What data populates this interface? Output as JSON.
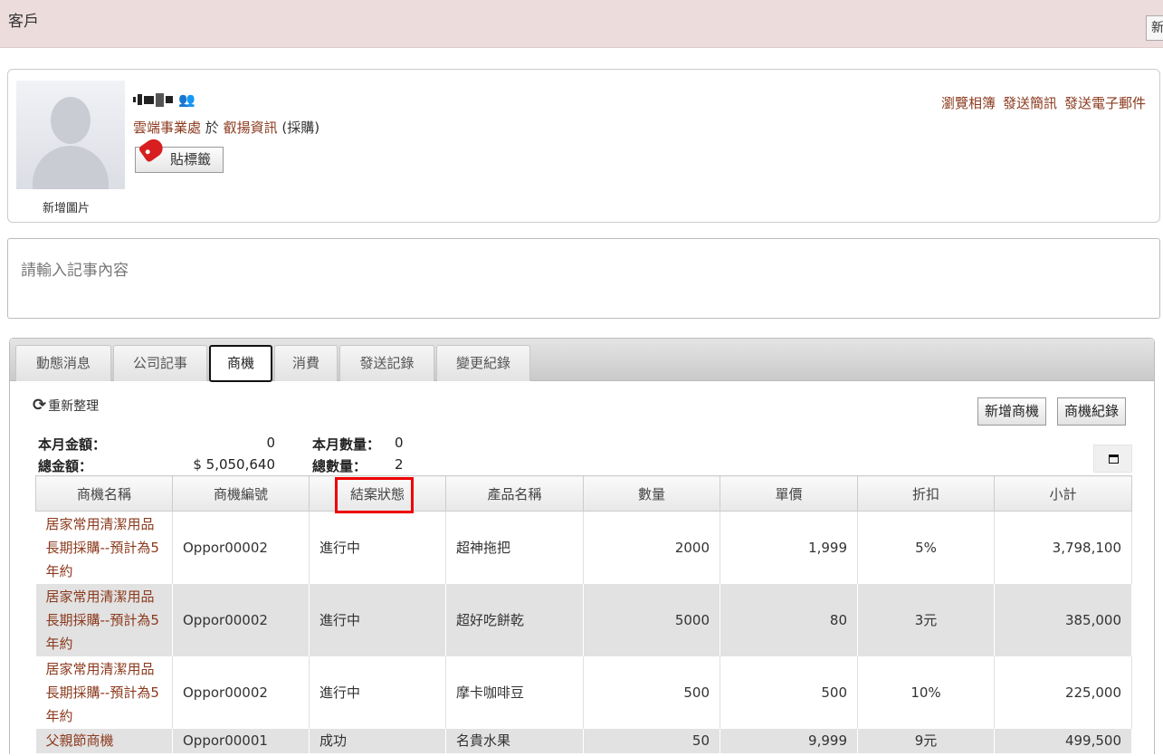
{
  "header": {
    "title": "客戶",
    "new_label": "新"
  },
  "profile": {
    "add_photo": "新增圖片",
    "department": "雲端事業處",
    "at": "於",
    "company": "叡揚資訊",
    "role": "(採購)",
    "tag_label": "貼標籤",
    "links": [
      "瀏覽相簿",
      "發送簡訊",
      "發送電子郵件"
    ]
  },
  "note": {
    "placeholder": "請輸入記事內容"
  },
  "tabs": [
    "動態消息",
    "公司記事",
    "商機",
    "消費",
    "發送記錄",
    "變更紀錄"
  ],
  "active_tab": "商機",
  "opportunities": {
    "refresh_label": "重新整理",
    "add_button": "新增商機",
    "log_button": "商機紀錄",
    "stats": {
      "month_amount_label": "本月金額：",
      "month_amount": "0",
      "month_qty_label": "本月數量：",
      "month_qty": "0",
      "total_amount_label": "總金額：",
      "total_amount": "$ 5,050,640",
      "total_qty_label": "總數量：",
      "total_qty": "2"
    },
    "columns": [
      "商機名稱",
      "商機編號",
      "結案狀態",
      "產品名稱",
      "數量",
      "單價",
      "折扣",
      "小計"
    ],
    "rows": [
      {
        "name": "居家常用清潔用品長期採購--預計為5年約",
        "id": "Oppor00002",
        "status": "進行中",
        "product": "超神拖把",
        "qty": "2000",
        "price": "1,999",
        "discount": "5%",
        "subtotal": "3,798,100"
      },
      {
        "name": "居家常用清潔用品長期採購--預計為5年約",
        "id": "Oppor00002",
        "status": "進行中",
        "product": "超好吃餅乾",
        "qty": "5000",
        "price": "80",
        "discount": "3元",
        "subtotal": "385,000"
      },
      {
        "name": "居家常用清潔用品長期採購--預計為5年約",
        "id": "Oppor00002",
        "status": "進行中",
        "product": "摩卡咖啡豆",
        "qty": "500",
        "price": "500",
        "discount": "10%",
        "subtotal": "225,000"
      },
      {
        "name": "父親節商機",
        "id": "Oppor00001",
        "status": "成功",
        "product": "名貴水果",
        "qty": "50",
        "price": "9,999",
        "discount": "9元",
        "subtotal": "499,500"
      }
    ]
  },
  "colors": {
    "link": "#8b3a1e",
    "header_bg": "#ecdcdc",
    "highlight": "#e00000"
  }
}
